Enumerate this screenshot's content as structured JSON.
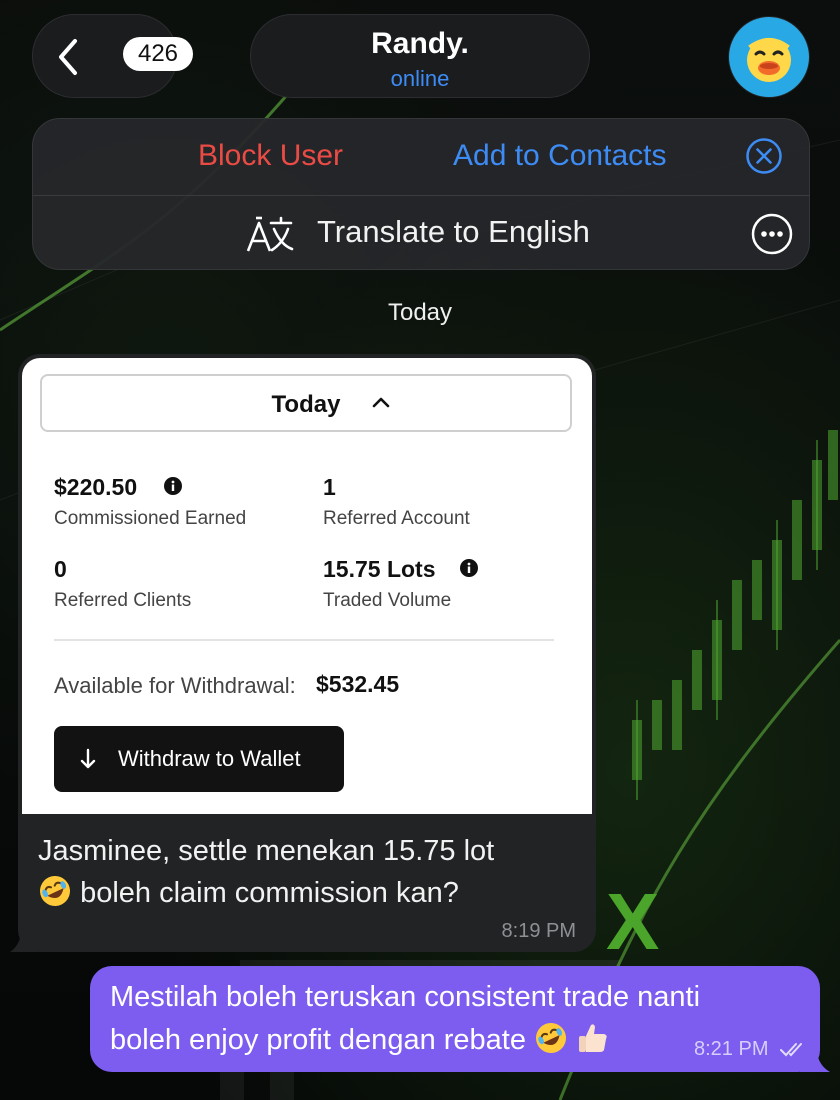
{
  "header": {
    "unread_count": "426",
    "contact_name": "Randy.",
    "status": "online"
  },
  "action_bar": {
    "block_label": "Block User",
    "add_contacts_label": "Add to Contacts",
    "translate_label": "Translate to English"
  },
  "date_separator": "Today",
  "incoming_message": {
    "screenshot": {
      "period_dropdown": "Today",
      "stats": [
        {
          "value": "$220.50",
          "label": "Commissioned Earned"
        },
        {
          "value": "1",
          "label": "Referred Account"
        },
        {
          "value": "0",
          "label": "Referred Clients"
        },
        {
          "value": "15.75 Lots",
          "label": "Traded Volume"
        }
      ],
      "available_label": "Available for Withdrawal:",
      "available_value": "$532.45",
      "withdraw_button": "Withdraw to Wallet"
    },
    "text_line1": "Jasminee, settle menekan 15.75 lot",
    "text_line2": "boleh claim commission kan?",
    "time": "8:19 PM"
  },
  "outgoing_message": {
    "text_line1": "Mestilah boleh teruskan consistent trade nanti",
    "text_line2": "boleh enjoy profit dengan rebate",
    "time": "8:21 PM"
  },
  "colors": {
    "block": "#eb4b45",
    "link": "#3d8cf5",
    "outgoing_bubble": "#7c5df0",
    "incoming_bubble": "#222325"
  }
}
